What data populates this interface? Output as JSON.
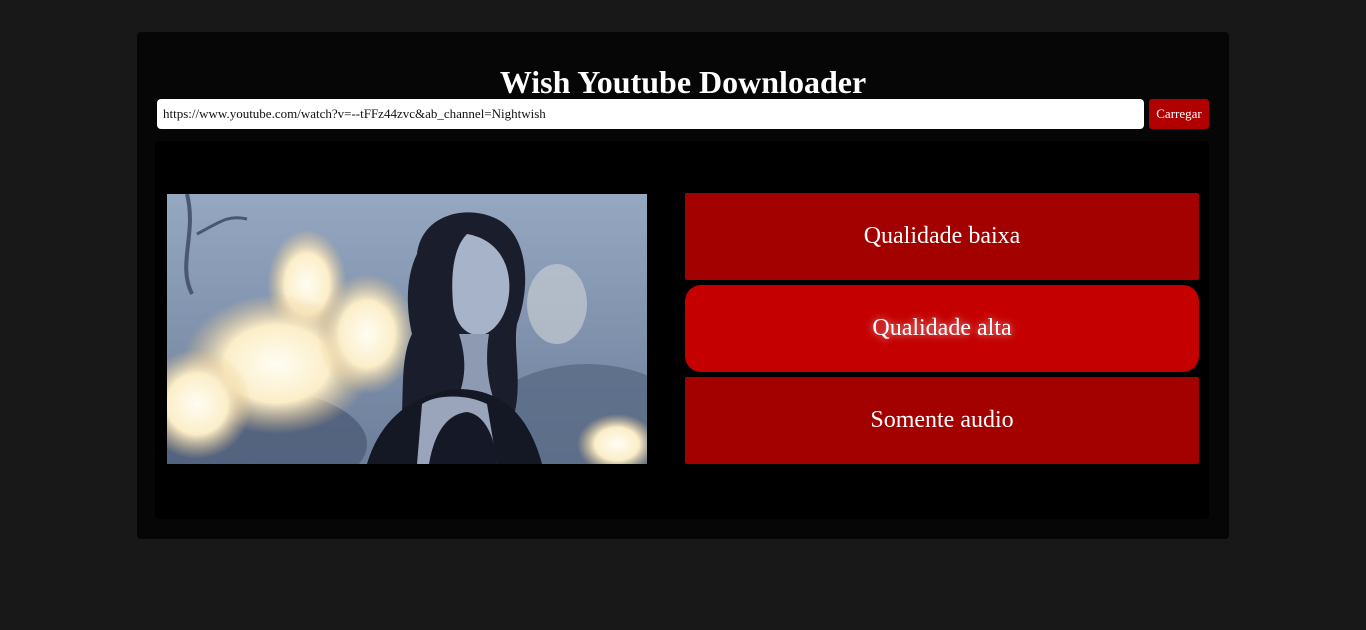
{
  "app": {
    "title": "Wish Youtube Downloader"
  },
  "url_bar": {
    "value": "https://www.youtube.com/watch?v=--tFFz44zvc&ab_channel=Nightwish",
    "load_label": "Carregar"
  },
  "thumbnail": {
    "alt": "Video thumbnail"
  },
  "options": {
    "low_label": "Qualidade baixa",
    "high_label": "Qualidade alta",
    "audio_label": "Somente audio"
  },
  "colors": {
    "background": "#181818",
    "card": "#060606",
    "accent": "#a30000",
    "accent_active": "#c40000"
  }
}
